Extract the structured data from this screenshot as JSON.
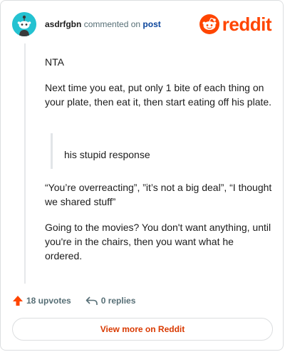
{
  "header": {
    "username": "asdrfgbn",
    "action_text": "commented on",
    "post_link": "post",
    "brand": "reddit",
    "avatar_icon": "snoo-avatar-icon",
    "brand_color": "#ff4500"
  },
  "comment": {
    "p1": "NTA",
    "p2": "Next time you eat, put only 1 bite of each thing on your plate, then eat it, then start eating off his plate.",
    "quote": "his stupid response",
    "p3": "“You’re overreacting”, ”it’s not a big deal”, “I thought we shared stuff”",
    "p4": "Going to the movies? You don't want anything, until you're in the chairs, then you want what he ordered."
  },
  "actions": {
    "upvotes": "18 upvotes",
    "replies": "0 replies",
    "upvote_icon": "upvote-arrow-icon",
    "reply_icon": "reply-arrow-icon"
  },
  "footer": {
    "view_more": "View more on Reddit"
  }
}
